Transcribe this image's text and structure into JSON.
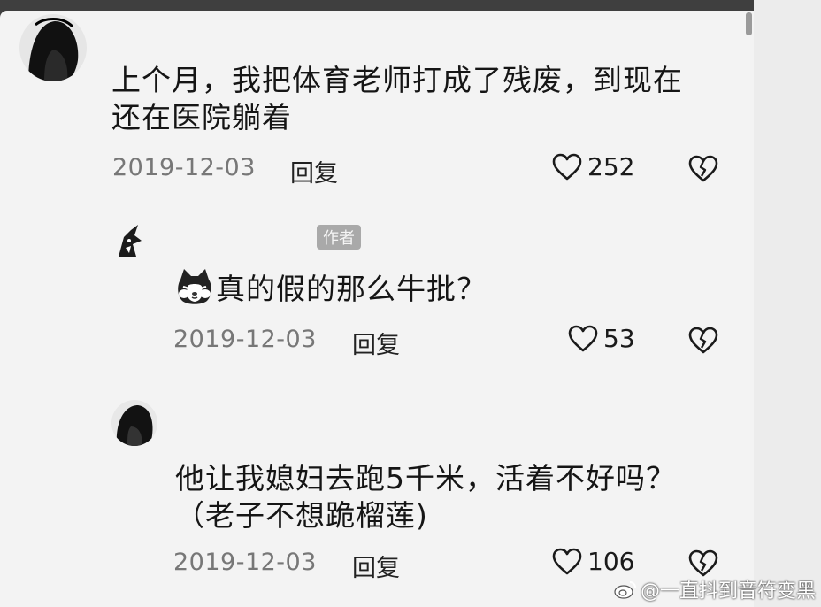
{
  "comments": [
    {
      "text": "上个月，我把体育老师打成了残废，到现在\n还在医院躺着",
      "date": "2019-12-03",
      "reply_label": "回复",
      "likes": "252"
    },
    {
      "author_badge": "作者",
      "text": "真的假的那么牛批？",
      "date": "2019-12-03",
      "reply_label": "回复",
      "likes": "53"
    },
    {
      "text": "他让我媳妇去跑5千米，活着不好吗？\n（老子不想跪榴莲)",
      "date": "2019-12-03",
      "reply_label": "回复",
      "likes": "106"
    }
  ],
  "watermark": {
    "text": "@一直抖到音符变黑"
  },
  "icons": {
    "like": "heart-outline-icon",
    "dislike": "broken-heart-icon",
    "emoji": "cat-face-emoji"
  },
  "colors": {
    "background": "#f3f3f3",
    "text": "#151515",
    "date": "#777777",
    "badge": "#a9a9a9"
  }
}
